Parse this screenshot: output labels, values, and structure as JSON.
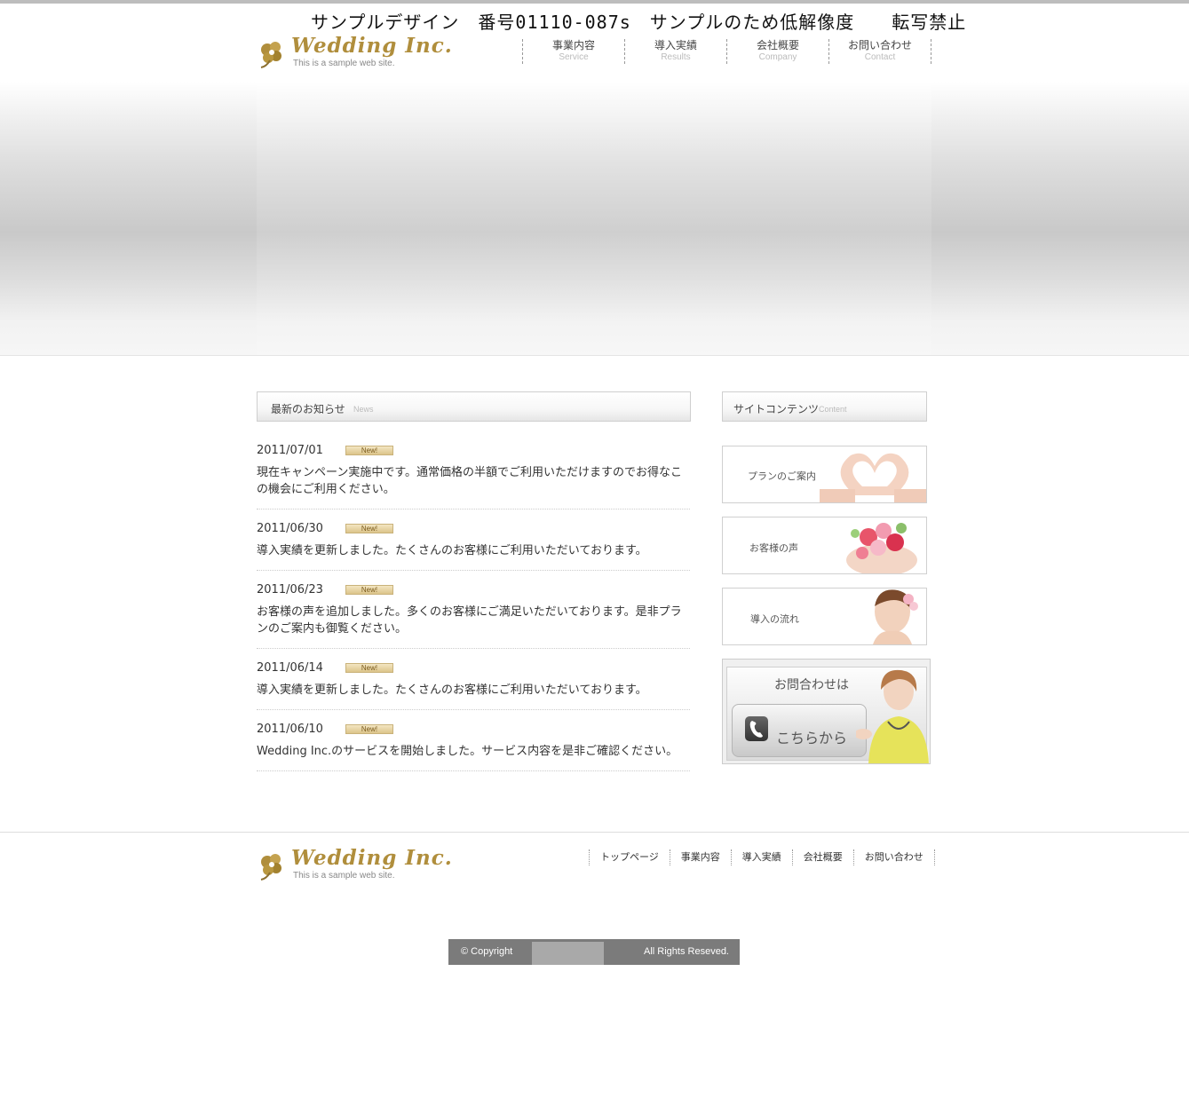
{
  "watermark": "サンプルデザイン　番号01110-087s　サンプルのため低解像度　　転写禁止",
  "logo": {
    "name": "Wedding Inc.",
    "tagline": "This is a sample web site."
  },
  "nav": [
    {
      "jp": "事業内容",
      "en": "Service"
    },
    {
      "jp": "導入実績",
      "en": "Results"
    },
    {
      "jp": "会社概要",
      "en": "Company"
    },
    {
      "jp": "お問い合わせ",
      "en": "Contact"
    }
  ],
  "news": {
    "heading_jp": "最新のお知らせ",
    "heading_en": "News",
    "badge": "New!",
    "items": [
      {
        "date": "2011/07/01",
        "text": "現在キャンペーン実施中です。通常価格の半額でご利用いただけますのでお得なこの機会にご利用ください。"
      },
      {
        "date": "2011/06/30",
        "text": "導入実績を更新しました。たくさんのお客様にご利用いただいております。"
      },
      {
        "date": "2011/06/23",
        "text": "お客様の声を追加しました。多くのお客様にご満足いただいております。是非プランのご案内も御覧ください。"
      },
      {
        "date": "2011/06/14",
        "text": "導入実績を更新しました。たくさんのお客様にご利用いただいております。"
      },
      {
        "date": "2011/06/10",
        "text": "Wedding Inc.のサービスを開始しました。サービス内容を是非ご確認ください。"
      }
    ]
  },
  "sidebar": {
    "heading_jp": "サイトコンテンツ",
    "heading_en": "Content",
    "banners": [
      {
        "label": "プランのご案内",
        "image": "heart-hands"
      },
      {
        "label": "お客様の声",
        "image": "flower-bouquet"
      },
      {
        "label": "導入の流れ",
        "image": "bride-portrait"
      }
    ],
    "contact": {
      "title": "お問合わせは",
      "button": "こちらから",
      "icon": "phone-icon"
    }
  },
  "footer": {
    "nav": [
      "トップページ",
      "事業内容",
      "導入実績",
      "会社概要",
      "お問い合わせ"
    ],
    "copyright_left": "© Copyright",
    "copyright_right": "All Rights Reseved."
  },
  "colors": {
    "brand_gold": "#b08e3c",
    "copyright_bar": "#7b7b7b"
  }
}
